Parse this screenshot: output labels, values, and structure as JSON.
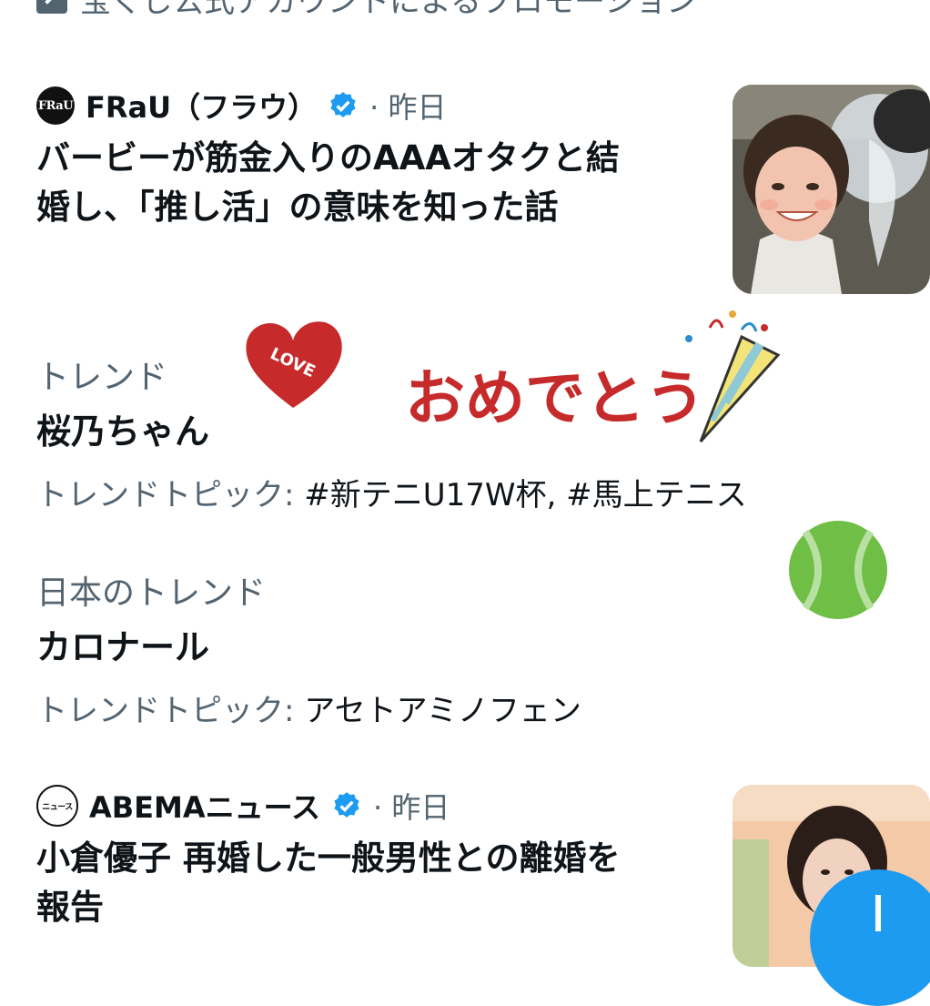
{
  "promoted": {
    "text": "宝くじ公式アカウントによるプロモーション"
  },
  "news1": {
    "source": "FRaU（フラウ）",
    "avatar_text": "FRaU",
    "time": "· 昨日",
    "headline_line1": "バービーが筋金入りのAAAオタクと結",
    "headline_line2": "婚し、「推し活」の意味を知った話"
  },
  "trend1": {
    "category": "トレンド",
    "name": "桜乃ちゃん",
    "topics_label": "トレンドトピック: ",
    "topics_value": "#新テニU17W杯, #馬上テニス",
    "sticker_heart_text": "LOVE",
    "sticker_banner_text": "おめでとう"
  },
  "trend2": {
    "category": "日本のトレンド",
    "name": "カロナール",
    "topics_label": "トレンドトピック: ",
    "topics_value": "アセトアミノフェン"
  },
  "news2": {
    "source": "ABEMAニュース",
    "avatar_text": "ニュース",
    "time": "· 昨日",
    "headline_line1": "小倉優子 再婚した一般男性との離婚を",
    "headline_line2": "報告"
  },
  "colors": {
    "accent": "#1d9bf0",
    "secondary_text": "#536471",
    "primary_text": "#0f1419",
    "heart": "#c62a2a"
  },
  "icons": [
    "promoted-icon",
    "verified-badge-icon",
    "tennis-ball-icon",
    "compose-icon"
  ]
}
